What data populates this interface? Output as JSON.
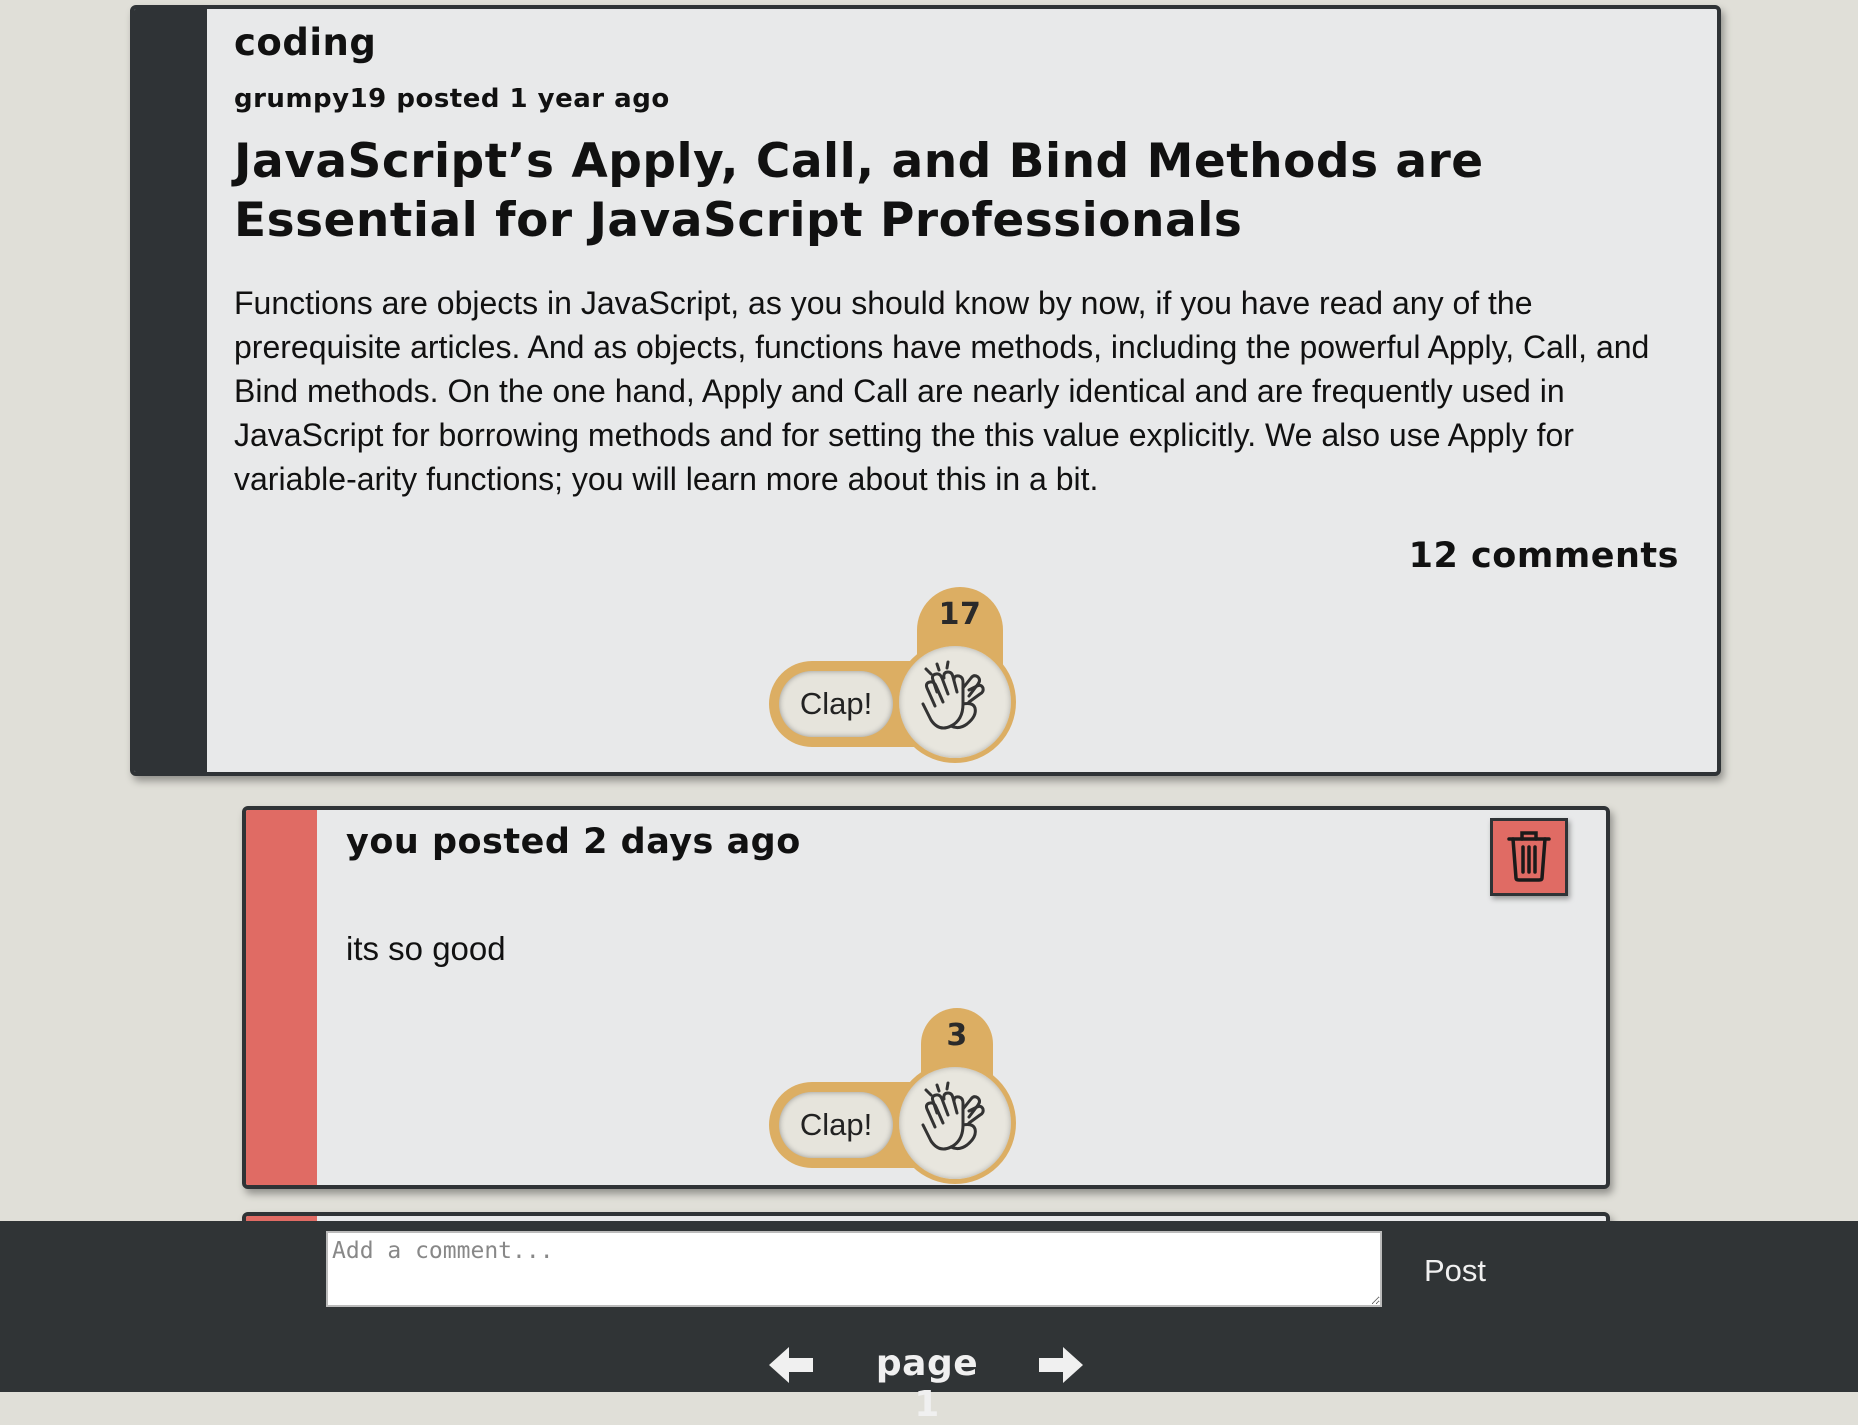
{
  "post": {
    "category": "coding",
    "author": "grumpy19",
    "posted_text": "posted 1 year ago",
    "title": "JavaScript’s Apply, Call, and Bind Methods are Essential for JavaScript Professionals",
    "excerpt": "Functions are objects in JavaScript, as you should know by now, if you have read any of the prerequisite articles. And as objects, functions have methods, including the powerful Apply, Call, and Bind methods. On the one hand, Apply and Call are nearly identical and are frequently used in JavaScript for borrowing methods and for setting the this value explicitly. We also use Apply for variable-arity functions; you will learn more about this in a bit.",
    "comments_count": "12 comments",
    "clap_label": "Clap!",
    "clap_count": "17",
    "clap_icon": "clapping-hands-icon"
  },
  "comments": [
    {
      "meta": "you posted 2 days ago",
      "body": "its so good",
      "clap_label": "Clap!",
      "clap_count": "3",
      "delete_icon": "trash-icon"
    }
  ],
  "footer": {
    "comment_placeholder": "Add a comment...",
    "post_label": "Post",
    "page_label": "page 1",
    "prev_icon": "arrow-left-icon",
    "next_icon": "arrow-right-icon"
  },
  "colors": {
    "background": "#e0dfd8",
    "card": "#e8e9ea",
    "dark": "#2f3336",
    "accent": "#e06b64",
    "clap_gold": "#dcae63"
  }
}
